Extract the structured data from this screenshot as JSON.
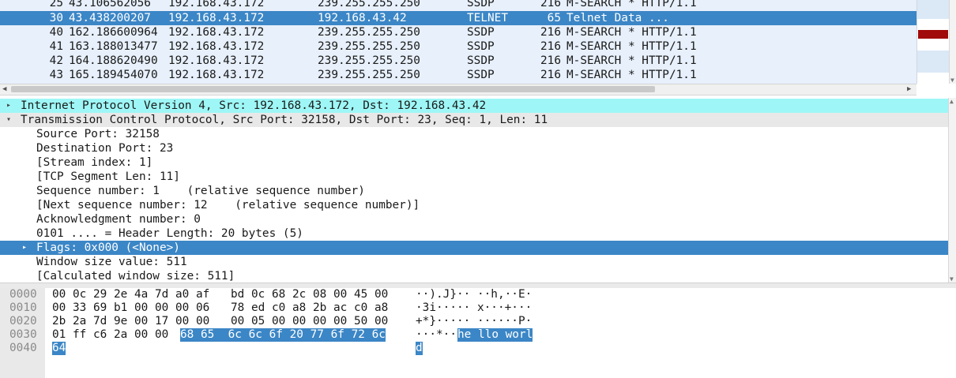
{
  "packet_list": {
    "rows": [
      {
        "no": "25",
        "time": "43.106562056",
        "src": "192.168.43.172",
        "dst": "239.255.255.250",
        "proto": "SSDP",
        "len": "216",
        "info": "M-SEARCH * HTTP/1.1",
        "selected": false
      },
      {
        "no": "30",
        "time": "43.438200207",
        "src": "192.168.43.172",
        "dst": "192.168.43.42",
        "proto": "TELNET",
        "len": "65",
        "info": "Telnet Data ...",
        "selected": true
      },
      {
        "no": "40",
        "time": "162.186600964",
        "src": "192.168.43.172",
        "dst": "239.255.255.250",
        "proto": "SSDP",
        "len": "216",
        "info": "M-SEARCH * HTTP/1.1",
        "selected": false
      },
      {
        "no": "41",
        "time": "163.188013477",
        "src": "192.168.43.172",
        "dst": "239.255.255.250",
        "proto": "SSDP",
        "len": "216",
        "info": "M-SEARCH * HTTP/1.1",
        "selected": false
      },
      {
        "no": "42",
        "time": "164.188620490",
        "src": "192.168.43.172",
        "dst": "239.255.255.250",
        "proto": "SSDP",
        "len": "216",
        "info": "M-SEARCH * HTTP/1.1",
        "selected": false
      },
      {
        "no": "43",
        "time": "165.189454070",
        "src": "192.168.43.172",
        "dst": "239.255.255.250",
        "proto": "SSDP",
        "len": "216",
        "info": "M-SEARCH * HTTP/1.1",
        "selected": false
      }
    ]
  },
  "details": {
    "rows": [
      {
        "text": "Internet Protocol Version 4, Src: 192.168.43.172, Dst: 192.168.43.42",
        "level": 0,
        "expander": "collapsed",
        "style": "cyan"
      },
      {
        "text": "Transmission Control Protocol, Src Port: 32158, Dst Port: 23, Seq: 1, Len: 11",
        "level": 0,
        "expander": "expanded",
        "style": "gray"
      },
      {
        "text": "Source Port: 32158",
        "level": 1,
        "expander": "none",
        "style": ""
      },
      {
        "text": "Destination Port: 23",
        "level": 1,
        "expander": "none",
        "style": ""
      },
      {
        "text": "[Stream index: 1]",
        "level": 1,
        "expander": "none",
        "style": ""
      },
      {
        "text": "[TCP Segment Len: 11]",
        "level": 1,
        "expander": "none",
        "style": ""
      },
      {
        "text": "Sequence number: 1    (relative sequence number)",
        "level": 1,
        "expander": "none",
        "style": ""
      },
      {
        "text": "[Next sequence number: 12    (relative sequence number)]",
        "level": 1,
        "expander": "none",
        "style": ""
      },
      {
        "text": "Acknowledgment number: 0",
        "level": 1,
        "expander": "none",
        "style": ""
      },
      {
        "text": "0101 .... = Header Length: 20 bytes (5)",
        "level": 1,
        "expander": "none",
        "style": ""
      },
      {
        "text": "Flags: 0x000 (<None>)",
        "level": 1,
        "expander": "collapsed",
        "style": "selected"
      },
      {
        "text": "Window size value: 511",
        "level": 1,
        "expander": "none",
        "style": ""
      },
      {
        "text": "[Calculated window size: 511]",
        "level": 1,
        "expander": "none",
        "style": ""
      }
    ]
  },
  "hex": {
    "rows": [
      {
        "offset": "0000",
        "b1": "00 0c 29 2e 4a 7d a0 af",
        "b2": "bd 0c 68 2c 08 00 45 00",
        "b2_sel": "",
        "ascii": "··).J}·· ··h,··E·",
        "ascii_sel": ""
      },
      {
        "offset": "0010",
        "b1": "00 33 69 b1 00 00 00 06",
        "b2": "78 ed c0 a8 2b ac c0 a8",
        "b2_sel": "",
        "ascii": "·3i····· x···+···",
        "ascii_sel": ""
      },
      {
        "offset": "0020",
        "b1": "2b 2a 7d 9e 00 17 00 00",
        "b2": "00 05 00 00 00 00 50 00",
        "b2_sel": "",
        "ascii": "+*}····· ······P·",
        "ascii_sel": ""
      },
      {
        "offset": "0030",
        "b1": "01 ff c6 2a 00 00",
        "b2": "",
        "b2_sel": "68 65  6c 6c 6f 20 77 6f 72 6c",
        "ascii": "···*··",
        "ascii_sel": "he llo worl"
      },
      {
        "offset": "0040",
        "b1": "",
        "b1_sel": "64",
        "b2": "",
        "b2_sel": "",
        "ascii": "",
        "ascii_sel": "d"
      }
    ]
  },
  "icons": {
    "expander_collapsed": "chevron-right-icon",
    "expander_expanded": "chevron-down-icon"
  },
  "colors": {
    "selection": "#3b86c6",
    "list_bg": "#e7f0fb",
    "ip_highlight": "#9ef7f6",
    "minimap_mark": "#a10a0a"
  }
}
